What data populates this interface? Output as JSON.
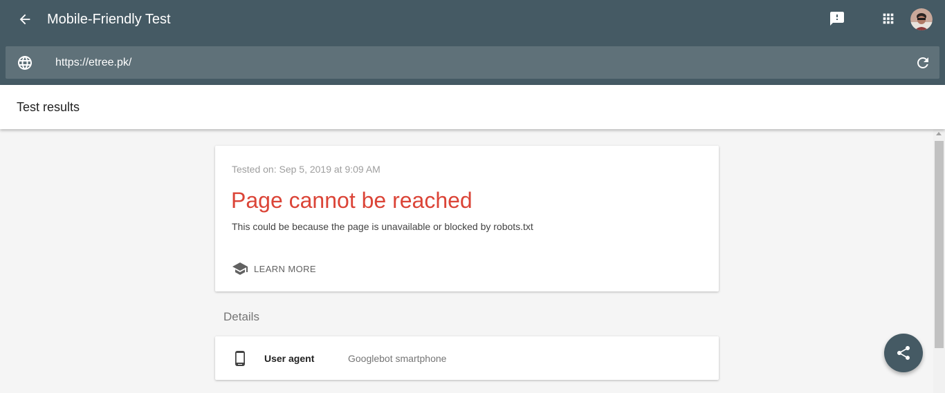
{
  "header": {
    "title": "Mobile-Friendly Test"
  },
  "urlbar": {
    "value": "https://etree.pk/"
  },
  "results_bar": {
    "title": "Test results"
  },
  "result_card": {
    "tested_on": "Tested on: Sep 5, 2019 at 9:09 AM",
    "title": "Page cannot be reached",
    "description": "This could be because the page is unavailable or blocked by robots.txt",
    "learn_more_label": "LEARN MORE"
  },
  "details": {
    "title": "Details",
    "rows": [
      {
        "label": "User agent",
        "value": "Googlebot smartphone",
        "icon": "smartphone-icon"
      }
    ]
  },
  "icons": {
    "back": "arrow-back-icon",
    "feedback": "feedback-icon",
    "apps": "apps-grid-icon",
    "globe": "globe-icon",
    "refresh": "refresh-icon",
    "learn": "school-icon",
    "share": "share-icon"
  },
  "colors": {
    "header_bg": "#455a64",
    "urlbar_bg": "#5f7179",
    "error_red": "#db4437",
    "page_bg": "#f5f5f5"
  }
}
